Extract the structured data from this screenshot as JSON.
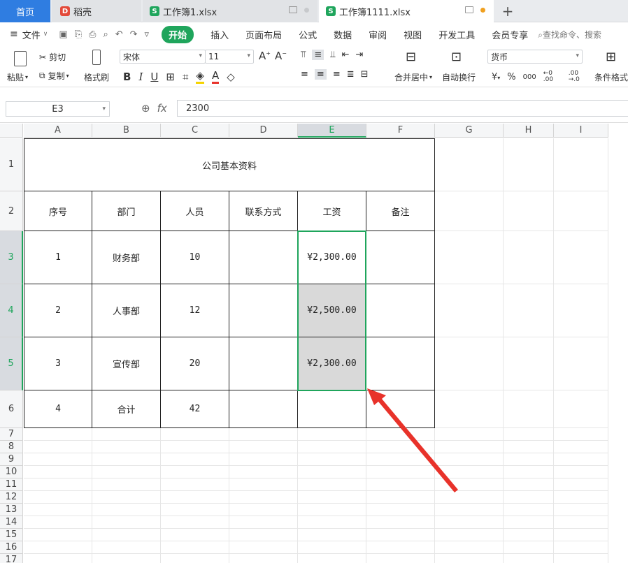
{
  "tabs": {
    "home": "首页",
    "docer": "稻壳",
    "file1": "工作簿1.xlsx",
    "file2": "工作簿1111.xlsx"
  },
  "menu": {
    "file": "文件",
    "start": "开始",
    "items": [
      "插入",
      "页面布局",
      "公式",
      "数据",
      "审阅",
      "视图",
      "开发工具",
      "会员专享"
    ],
    "search": "查找命令、搜索"
  },
  "ribbon": {
    "paste": "粘贴",
    "cut": "剪切",
    "copy": "复制",
    "format_painter": "格式刷",
    "font_name": "宋体",
    "font_size": "11",
    "merge_center": "合并居中",
    "wrap_text": "自动换行",
    "number_format": "货币",
    "cond_format": "条件格式",
    "currency_symbol": "¥",
    "percent_symbol": "%",
    "thousands": "000",
    "inc_decimal": "←0 .00",
    "dec_decimal": ".00 →.0"
  },
  "formula": {
    "name_box": "E3",
    "fx": "fx",
    "value": "2300"
  },
  "columns": [
    "A",
    "B",
    "C",
    "D",
    "E",
    "F",
    "G",
    "H",
    "I"
  ],
  "rows": [
    "1",
    "2",
    "3",
    "4",
    "5",
    "6",
    "7",
    "8",
    "9",
    "10",
    "11",
    "12",
    "13",
    "14",
    "15",
    "16",
    "17"
  ],
  "sheet": {
    "title": "公司基本资料",
    "headers": [
      "序号",
      "部门",
      "人员",
      "联系方式",
      "工资",
      "备注"
    ],
    "data": [
      [
        "1",
        "财务部",
        "10",
        "",
        "¥2,300.00",
        ""
      ],
      [
        "2",
        "人事部",
        "12",
        "",
        "¥2,500.00",
        ""
      ],
      [
        "3",
        "宣传部",
        "20",
        "",
        "¥2,300.00",
        ""
      ],
      [
        "4",
        "合计",
        "42",
        "",
        "",
        ""
      ]
    ]
  },
  "colors": {
    "accent_green": "#1fa55c",
    "home_blue": "#2f7de1",
    "arrow_red": "#e8322a"
  }
}
